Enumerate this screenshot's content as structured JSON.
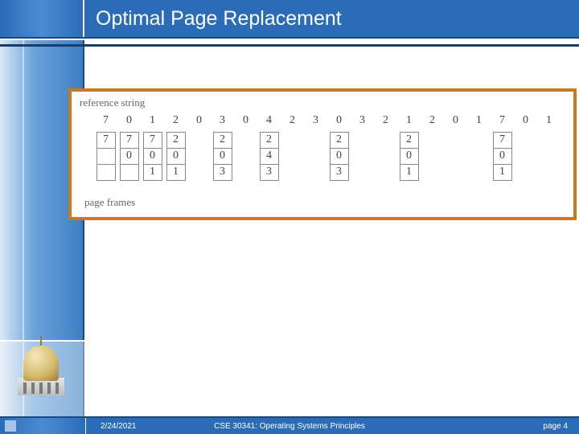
{
  "header": {
    "title": "Optimal Page Replacement"
  },
  "figure": {
    "label_top": "reference string",
    "label_bottom": "page frames",
    "reference_string": [
      "7",
      "0",
      "1",
      "2",
      "0",
      "3",
      "0",
      "4",
      "2",
      "3",
      "0",
      "3",
      "2",
      "1",
      "2",
      "0",
      "1",
      "7",
      "0",
      "1"
    ],
    "frame_columns": [
      {
        "show": true,
        "cells": [
          "7",
          " ",
          " "
        ]
      },
      {
        "show": true,
        "cells": [
          "7",
          "0",
          " "
        ]
      },
      {
        "show": true,
        "cells": [
          "7",
          "0",
          "1"
        ]
      },
      {
        "show": true,
        "cells": [
          "2",
          "0",
          "1"
        ]
      },
      {
        "show": false,
        "cells": []
      },
      {
        "show": true,
        "cells": [
          "2",
          "0",
          "3"
        ]
      },
      {
        "show": false,
        "cells": []
      },
      {
        "show": true,
        "cells": [
          "2",
          "4",
          "3"
        ]
      },
      {
        "show": false,
        "cells": []
      },
      {
        "show": false,
        "cells": []
      },
      {
        "show": true,
        "cells": [
          "2",
          "0",
          "3"
        ]
      },
      {
        "show": false,
        "cells": []
      },
      {
        "show": false,
        "cells": []
      },
      {
        "show": true,
        "cells": [
          "2",
          "0",
          "1"
        ]
      },
      {
        "show": false,
        "cells": []
      },
      {
        "show": false,
        "cells": []
      },
      {
        "show": false,
        "cells": []
      },
      {
        "show": true,
        "cells": [
          "7",
          "0",
          "1"
        ]
      },
      {
        "show": false,
        "cells": []
      },
      {
        "show": false,
        "cells": []
      }
    ]
  },
  "footer": {
    "date": "2/24/2021",
    "course": "CSE 30341: Operating Systems Principles",
    "page": "page 4"
  }
}
